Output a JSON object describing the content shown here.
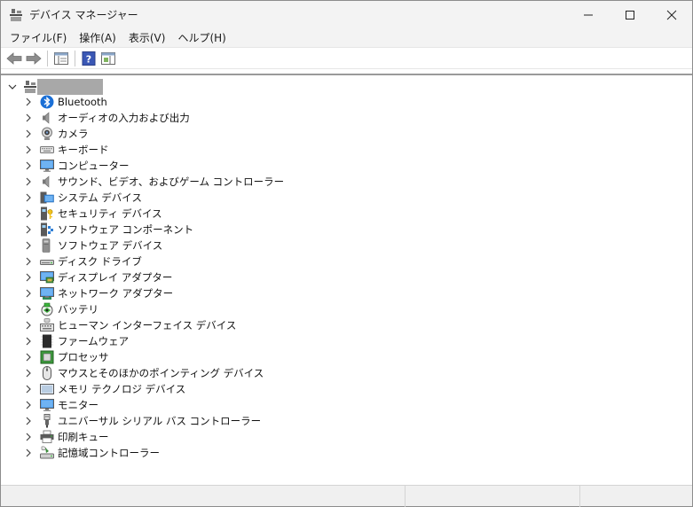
{
  "window": {
    "title": "デバイス マネージャー"
  },
  "menubar": {
    "items": [
      {
        "label": "ファイル(F)"
      },
      {
        "label": "操作(A)"
      },
      {
        "label": "表示(V)"
      },
      {
        "label": "ヘルプ(H)"
      }
    ]
  },
  "toolbar": {
    "buttons": [
      {
        "icon": "back-arrow-icon"
      },
      {
        "icon": "forward-arrow-icon"
      },
      {
        "icon": "properties-icon"
      },
      {
        "icon": "help-icon"
      },
      {
        "icon": "action-pane-icon"
      }
    ]
  },
  "tree": {
    "root": {
      "icon": "computer-root-icon",
      "name": ""
    },
    "categories": [
      {
        "label": "Bluetooth",
        "icon": "bluetooth-icon"
      },
      {
        "label": "オーディオの入力および出力",
        "icon": "speaker-icon"
      },
      {
        "label": "カメラ",
        "icon": "camera-icon"
      },
      {
        "label": "キーボード",
        "icon": "keyboard-icon"
      },
      {
        "label": "コンピューター",
        "icon": "monitor-icon"
      },
      {
        "label": "サウンド、ビデオ、およびゲーム コントローラー",
        "icon": "speaker-icon"
      },
      {
        "label": "システム デバイス",
        "icon": "system-folder-icon"
      },
      {
        "label": "セキュリティ デバイス",
        "icon": "security-key-icon"
      },
      {
        "label": "ソフトウェア コンポーネント",
        "icon": "software-component-icon"
      },
      {
        "label": "ソフトウェア デバイス",
        "icon": "software-device-icon"
      },
      {
        "label": "ディスク ドライブ",
        "icon": "disk-drive-icon"
      },
      {
        "label": "ディスプレイ アダプター",
        "icon": "display-adapter-icon"
      },
      {
        "label": "ネットワーク アダプター",
        "icon": "network-adapter-icon"
      },
      {
        "label": "バッテリ",
        "icon": "battery-icon"
      },
      {
        "label": "ヒューマン インターフェイス デバイス",
        "icon": "hid-icon"
      },
      {
        "label": "ファームウェア",
        "icon": "firmware-chip-icon"
      },
      {
        "label": "プロセッサ",
        "icon": "processor-icon"
      },
      {
        "label": "マウスとそのほかのポインティング デバイス",
        "icon": "mouse-icon"
      },
      {
        "label": "メモリ テクノロジ デバイス",
        "icon": "memory-icon"
      },
      {
        "label": "モニター",
        "icon": "monitor-icon"
      },
      {
        "label": "ユニバーサル シリアル バス コントローラー",
        "icon": "usb-icon"
      },
      {
        "label": "印刷キュー",
        "icon": "printer-icon"
      },
      {
        "label": "記憶域コントローラー",
        "icon": "storage-controller-icon"
      }
    ]
  }
}
